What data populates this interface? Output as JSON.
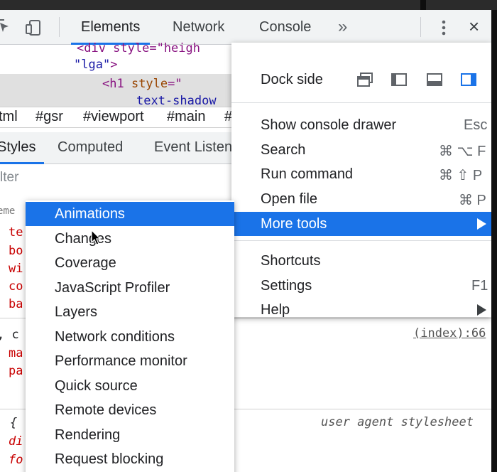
{
  "toolbar": {
    "tabs": [
      "Elements",
      "Network",
      "Console"
    ],
    "more_tabs_icon": "»",
    "close_icon": "×"
  },
  "dom": {
    "line1": "<div style=\"heigh",
    "line2_str": "\"lga\"",
    "line2_end": ">",
    "line3_tag": "<h1 ",
    "line3_attr": "style",
    "line3_eq": "=\"",
    "line4": "text-shadow"
  },
  "breadcrumbs": [
    "tml",
    "#gsr",
    "#viewport",
    "#main",
    "#"
  ],
  "subtabs": [
    "Styles",
    "Computed",
    "Event Listen"
  ],
  "filter": {
    "placeholder": "lter"
  },
  "styles": {
    "element_label": "eme",
    "props_a": [
      "te",
      "bo",
      "wi",
      "co",
      "ba"
    ],
    "selector_b": ", c",
    "props_b": [
      "ma",
      "pa"
    ],
    "source_link": "(index):66",
    "selector_c": "{",
    "props_c": [
      "di",
      "fo"
    ],
    "ua_label": "user agent stylesheet"
  },
  "main_menu": {
    "dock_label": "Dock side",
    "items_group1": [
      {
        "label": "Show console drawer",
        "shortcut": "Esc"
      },
      {
        "label": "Search",
        "shortcut": "⌘ ⌥ F"
      },
      {
        "label": "Run command",
        "shortcut": "⌘ ⇧ P"
      },
      {
        "label": "Open file",
        "shortcut": "⌘ P"
      },
      {
        "label": "More tools",
        "shortcut": ""
      }
    ],
    "items_group2": [
      {
        "label": "Shortcuts",
        "shortcut": ""
      },
      {
        "label": "Settings",
        "shortcut": "F1"
      },
      {
        "label": "Help",
        "shortcut": ""
      }
    ],
    "highlight_color": "#1a73e8"
  },
  "more_tools_menu": {
    "items": [
      "Animations",
      "Changes",
      "Coverage",
      "JavaScript Profiler",
      "Layers",
      "Network conditions",
      "Performance monitor",
      "Quick source",
      "Remote devices",
      "Rendering",
      "Request blocking"
    ],
    "highlighted": "Animations"
  }
}
